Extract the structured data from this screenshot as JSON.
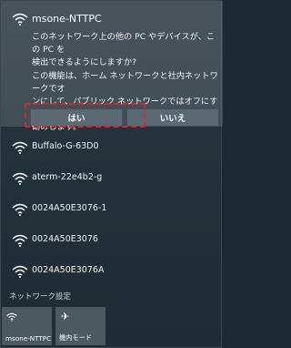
{
  "connected": {
    "name": "msone-NTTPC",
    "message1": "このネットワーク上の他の PC やデバイスが、この PC を\n検出できるようにしますか?",
    "message2": "この機能は、ホーム ネットワークと社内ネットワークでオ\nンにして、パブリック ネットワークではオフにすることをお\n勧めします。",
    "yes_label": "はい",
    "no_label": "いいえ"
  },
  "networks": [
    {
      "name": "Buffalo-G-63D0"
    },
    {
      "name": "aterm-22e4b2-g"
    },
    {
      "name": "0024A50E3076-1"
    },
    {
      "name": "0024A50E3076"
    },
    {
      "name": "0024A50E3076A"
    }
  ],
  "settings_label": "ネットワーク設定",
  "tiles": [
    {
      "label": "msone-NTTPC",
      "icon": "wifi-icon"
    },
    {
      "label": "機内モード",
      "icon": "airplane-icon"
    }
  ],
  "colors": {
    "highlight": "#d8262b",
    "button": "#5a6973",
    "tile": "#4d5960"
  }
}
